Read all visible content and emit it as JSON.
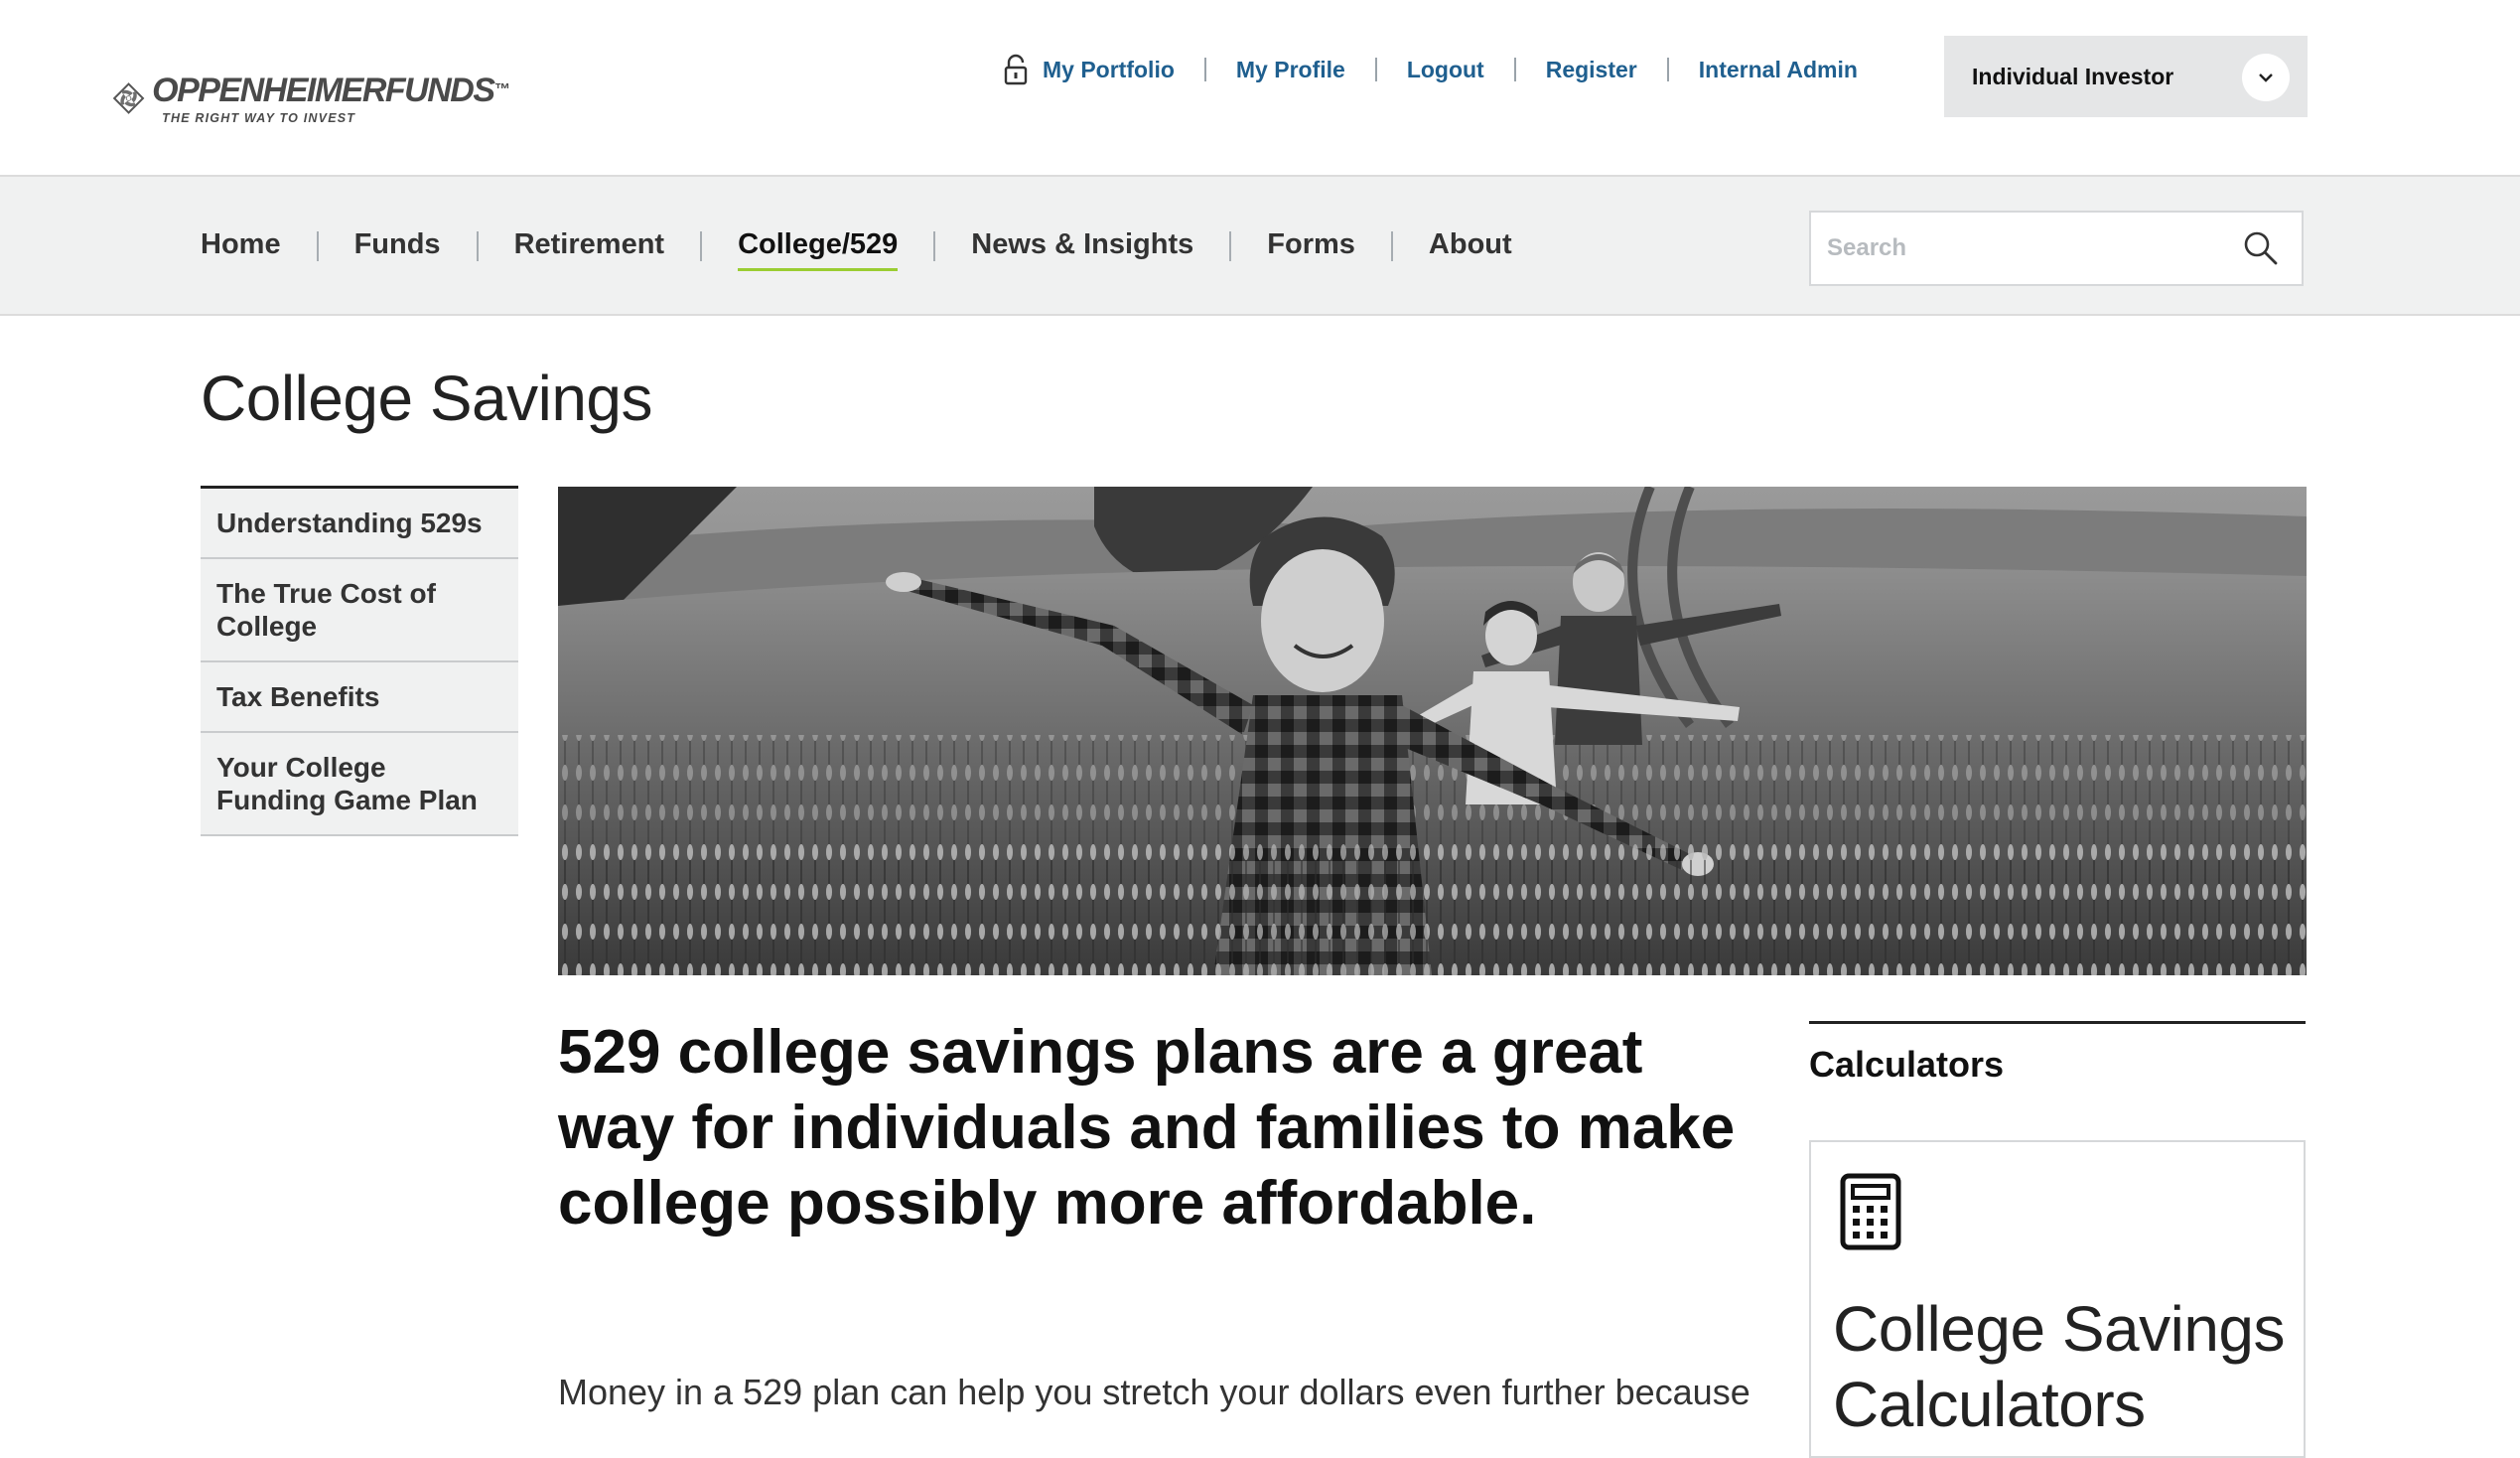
{
  "brand": {
    "name": "OPPENHEIMERFUNDS",
    "trademark": "™",
    "tagline": "THE RIGHT WAY TO INVEST"
  },
  "utility_nav": {
    "portfolio": "My Portfolio",
    "profile": "My Profile",
    "logout": "Logout",
    "register": "Register",
    "admin": "Internal Admin"
  },
  "investor_select": {
    "value": "Individual Investor"
  },
  "main_nav": {
    "items": [
      {
        "label": "Home"
      },
      {
        "label": "Funds"
      },
      {
        "label": "Retirement"
      },
      {
        "label": "College/529"
      },
      {
        "label": "News & Insights"
      },
      {
        "label": "Forms"
      },
      {
        "label": "About"
      }
    ],
    "active": "College/529",
    "accent": "#9acd32"
  },
  "search": {
    "placeholder": "Search"
  },
  "page": {
    "title": "College Savings"
  },
  "side_nav": {
    "items": [
      {
        "label": "Understanding 529s"
      },
      {
        "label": "The True Cost of College"
      },
      {
        "label": "Tax Benefits"
      },
      {
        "label": "Your College Funding Game Plan"
      }
    ]
  },
  "main": {
    "headline": "529 college savings plans are a great way for individuals and families to make college possibly more affordable.",
    "body": "Money in a 529 plan can help you stretch your dollars even further because"
  },
  "calculators": {
    "heading": "Calculators",
    "card_title": "College Savings Calculators"
  },
  "colors": {
    "link": "#1f5f8f",
    "nav_bg": "#f0f1f1",
    "select_bg": "#e5e6e7"
  }
}
